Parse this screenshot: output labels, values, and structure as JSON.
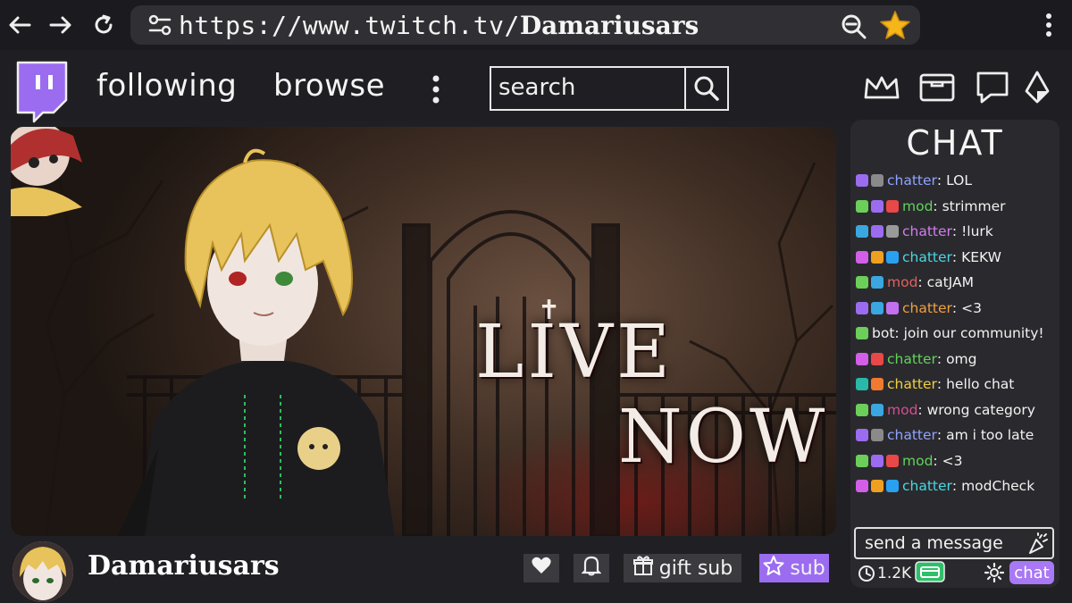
{
  "browser": {
    "url_prefix": "https://www.twitch.tv/",
    "url_channel": "Damariusars"
  },
  "nav": {
    "following": "following",
    "browse": "browse",
    "search_placeholder": "search"
  },
  "stream": {
    "live_word1": "LIVE",
    "live_word2": "NOW"
  },
  "channel": {
    "name": "Damariusars",
    "gift_sub": "gift sub",
    "sub": "sub"
  },
  "chat": {
    "title": "CHAT",
    "input_placeholder": "send a message",
    "viewer_count": "1.2K",
    "chat_button": "chat",
    "messages": [
      {
        "badges": [
          "#9b6cf0",
          "#8a8a8a"
        ],
        "user": "chatter",
        "user_color": "#8fa3ff",
        "text": "LOL"
      },
      {
        "badges": [
          "#6bcf5a",
          "#9b6cf0",
          "#e84848"
        ],
        "user": "mod",
        "user_color": "#62d25c",
        "text": "strimmer"
      },
      {
        "badges": [
          "#3aa7e0",
          "#9b6cf0",
          "#9a9a9a"
        ],
        "user": "chatter",
        "user_color": "#d27cf0",
        "text": "!lurk"
      },
      {
        "badges": [
          "#d35fe8",
          "#f0a020",
          "#2aa0f0"
        ],
        "user": "chatter",
        "user_color": "#48d8e0",
        "text": "KEKW"
      },
      {
        "badges": [
          "#6bcf5a",
          "#3aa7e0"
        ],
        "user": "mod",
        "user_color": "#e06060",
        "text": "catJAM"
      },
      {
        "badges": [
          "#9b6cf0",
          "#3aa7e0",
          "#c070f0"
        ],
        "user": "chatter",
        "user_color": "#f0a040",
        "text": "<3"
      },
      {
        "badges": [
          "#6bcf5a"
        ],
        "user": "bot",
        "user_color": "#f2f2f2",
        "text": "join our community!"
      },
      {
        "badges": [
          "#d35fe8",
          "#e84848"
        ],
        "user": "chatter",
        "user_color": "#62d25c",
        "text": "omg"
      },
      {
        "badges": [
          "#2ab8a8",
          "#f07a30"
        ],
        "user": "chatter",
        "user_color": "#f0d040",
        "text": "hello chat"
      },
      {
        "badges": [
          "#6bcf5a",
          "#3aa7e0"
        ],
        "user": "mod",
        "user_color": "#d05090",
        "text": "wrong category"
      },
      {
        "badges": [
          "#9b6cf0",
          "#8a8a8a"
        ],
        "user": "chatter",
        "user_color": "#8fa3ff",
        "text": "am i too late"
      },
      {
        "badges": [
          "#6bcf5a",
          "#9b6cf0",
          "#e84848"
        ],
        "user": "mod",
        "user_color": "#62d25c",
        "text": "<3"
      },
      {
        "badges": [
          "#d35fe8",
          "#f0a020",
          "#2aa0f0"
        ],
        "user": "chatter",
        "user_color": "#48d8e0",
        "text": "modCheck"
      }
    ]
  },
  "colors": {
    "twitch_purple": "#9b6cf0",
    "chat_button": "#a878f5",
    "star": "#f5b61a",
    "background": "#202024"
  }
}
